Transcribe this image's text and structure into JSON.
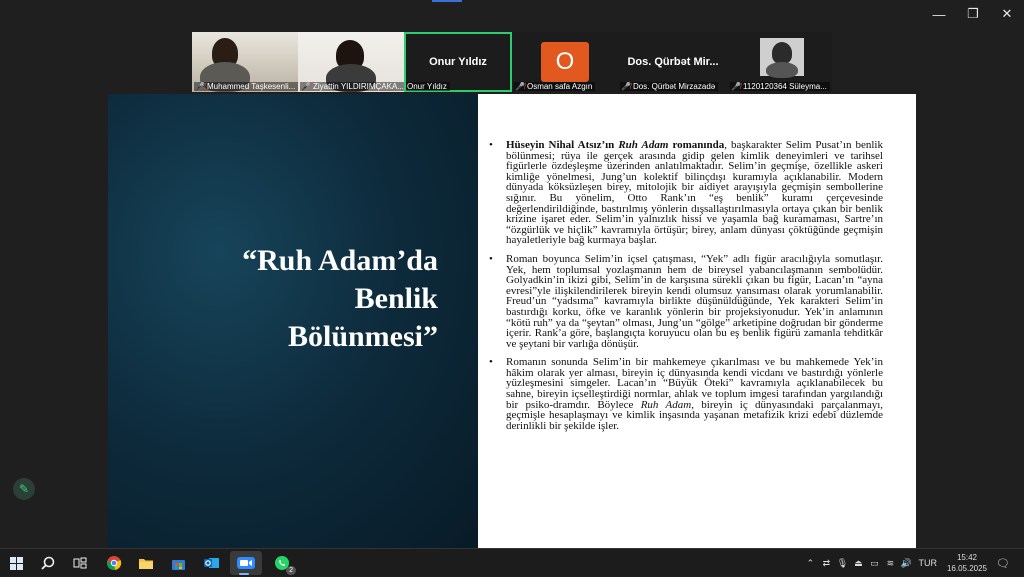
{
  "window": {
    "controls": [
      "minimize",
      "restore",
      "close"
    ]
  },
  "participants": [
    {
      "name": "Muhammed Taşkesenli...",
      "kind": "video",
      "muted": true
    },
    {
      "name": "Ziyattin YILDIRIMÇAKA...",
      "kind": "video",
      "muted": true
    },
    {
      "name": "Onur Yıldız",
      "kind": "name",
      "display": "Onur Yıldız",
      "muted": false,
      "active": true
    },
    {
      "name": "Osman safa Azgın",
      "kind": "avatar",
      "display": "O",
      "muted": true
    },
    {
      "name": "Dos. Qürbət Mirzazadə",
      "kind": "name",
      "display": "Dos. Qürbət Mir...",
      "muted": true
    },
    {
      "name": "1120120364 Süleyma...",
      "kind": "video",
      "muted": true
    }
  ],
  "slide": {
    "title_lines": [
      "“Ruh Adam’da",
      "Benlik",
      "Bölünmesi”"
    ],
    "bullets": [
      {
        "bold": "Hüseyin Nihal Atsız’ın ",
        "italic": "Ruh Adam",
        "bold2": " romanında",
        "text": ", başkarakter Selim Pusat’ın benlik bölünmesi; rüya ile gerçek arasında gidip gelen kimlik deneyimleri ve tarihsel figürlerle özdeşleşme üzerinden anlatılmaktadır. Selim’in geçmişe, özellikle askeri kimliğe yönelmesi, Jung’un kolektif bilinçdışı kuramıyla açıklanabilir. Modern dünyada köksüzleşen birey, mitolojik bir aidiyet arayışıyla geçmişin sembollerine sığınır. Bu yönelim, Otto Rank’ın “eş benlik” kuramı çerçevesinde değerlendirildiğinde, bastırılmış yönlerin dışsallaştırılmasıyla ortaya çıkan bir benlik krizine işaret eder. Selim’in yalnızlık hissi ve yaşamla bağ kuramaması, Sartre’ın “özgürlük ve hiçlik” kavramıyla örtüşür; birey, anlam dünyası çöktüğünde geçmişin hayaletleriyle bağ kurmaya başlar."
      },
      {
        "text": "Roman boyunca Selim’in içsel çatışması, “Yek” adlı figür aracılığıyla somutlaşır. Yek, hem toplumsal yozlaşmanın hem de bireysel yabancılaşmanın sembolüdür. Golyadkin’in ikizi gibi, Selim’in de karşısına sürekli çıkan bu figür, Lacan’ın “ayna evresi”yle ilişkilendirilerek bireyin kendi olumsuz yansıması olarak yorumlanabilir. Freud’un “yadsıma” kavramıyla birlikte düşünüldüğünde, Yek karakteri Selim’in bastırdığı korku, öfke ve karanlık yönlerin bir projeksiyonudur. Yek’in anlamının “kötü ruh” ya da “şeytan” olması, Jung’un “gölge” arketipine doğrudan bir gönderme içerir. Rank’a göre, başlangıçta koruyucu olan bu eş benlik figürü zamanla tehditkâr ve şeytani bir varlığa dönüşür."
      },
      {
        "text": "Romanın sonunda Selim’in bir mahkemeye çıkarılması ve bu mahkemede Yek’in hâkim olarak yer alması, bireyin iç dünyasında kendi vicdanı ve bastırdığı yönlerle yüzleşmesini simgeler. Lacan’ın “Büyük Öteki” kavramıyla açıklanabilecek bu sahne, bireyin içselleştirdiği normlar, ahlak ve toplum imgesi tarafından yargılandığı bir psiko-dramdır. Böylece ",
        "italic": "Ruh Adam",
        "text2": ", bireyin iç dünyasındaki parçalanmayı, geçmişle hesaplaşmayı ve kimlik inşasında yaşanan metafizik krizi edebî düzlemde derinlikli bir şekilde işler."
      }
    ]
  },
  "taskbar": {
    "apps": [
      "windows-start",
      "search",
      "task-view",
      "chrome",
      "file-explorer",
      "microsoft-store",
      "outlook",
      "zoom",
      "whatsapp"
    ],
    "whatsapp_badge": "2",
    "language": "TUR",
    "time": "15:42",
    "date": "16.05.2025"
  }
}
